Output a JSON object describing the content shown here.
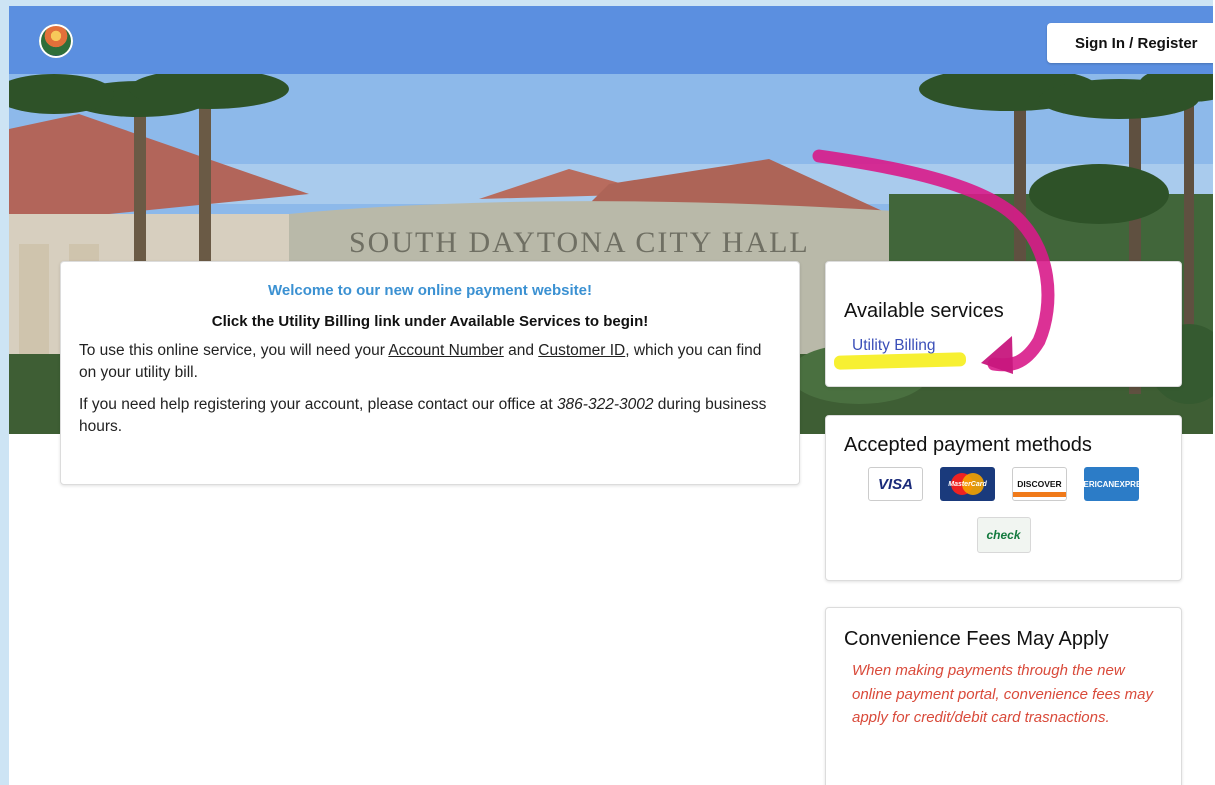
{
  "header": {
    "signin_label": "Sign In / Register"
  },
  "hero": {
    "building_sign": "SOUTH DAYTONA CITY HALL"
  },
  "welcome": {
    "heading": "Welcome to our new online payment website!",
    "subheading": "Click the Utility Billing link under Available Services to begin!",
    "para1_before": "To use this online service, you will need your ",
    "account_number": "Account Number",
    "para1_and": " and ",
    "customer_id": "Customer ID",
    "para1_after": ", which you can find on your utility bill.",
    "para2_before": "If you need help registering your account, please contact our office at ",
    "phone": "386-322-3002",
    "para2_after": " during business hours."
  },
  "services": {
    "title": "Available services",
    "link": "Utility Billing"
  },
  "methods": {
    "title": "Accepted payment methods",
    "visa": "VISA",
    "mastercard": "MasterCard",
    "discover": "DISCOVER",
    "amex_line1": "AMERICAN",
    "amex_line2": "EXPRESS",
    "check": "check"
  },
  "fees": {
    "title": "Convenience Fees May Apply",
    "note": "When making payments through the new online payment portal, convenience fees may apply for credit/debit card trasnactions."
  },
  "colors": {
    "topbar": "#5b8fe0",
    "welcome_heading": "#3b91d2",
    "link": "#3b4fb8",
    "fee_note": "#d94a3a",
    "annotation_arrow": "#d81b8a",
    "annotation_highlight": "#f6ee1c"
  }
}
